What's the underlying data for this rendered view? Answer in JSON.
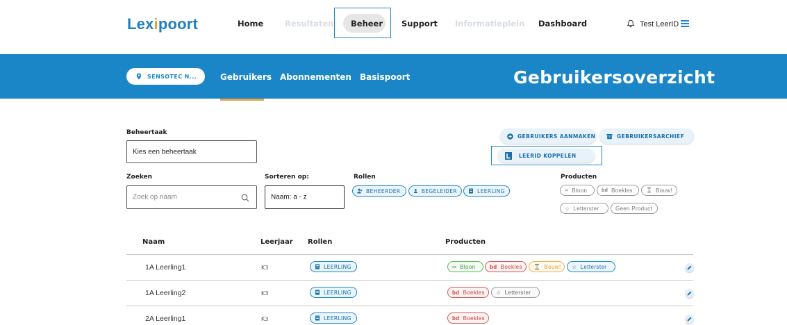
{
  "nav": {
    "logo_prefix": "Lex",
    "logo_i": "i",
    "logo_suffix": "poort",
    "items": [
      {
        "label": "Home",
        "disabled": false
      },
      {
        "label": "Resultaten",
        "disabled": true
      },
      {
        "label": "Beheer",
        "active": true
      },
      {
        "label": "Support",
        "disabled": false
      },
      {
        "label": "Informatieplein",
        "disabled": true
      },
      {
        "label": "Dashboard",
        "disabled": false
      }
    ],
    "user_name": "Test LeerID",
    "bell_icon": "bell-icon",
    "menu_icon": "hamburger-menu-icon"
  },
  "banner": {
    "org_label": "SENSOTEC N...",
    "tabs": [
      "Gebruikers",
      "Abonnementen",
      "Basispoort"
    ],
    "active_tab": "Gebruikers",
    "title": "Gebruikersoverzicht",
    "color": "#1a86c8",
    "accent": "#e6a24b"
  },
  "filters": {
    "beheertaak_label": "Beheertaak",
    "beheertaak_value": "Kies een beheertaak",
    "zoeken_label": "Zoeken",
    "zoeken_placeholder": "Zoek op naam",
    "sorteren_label": "Sorteren op:",
    "sorteren_value": "Naam: a - z",
    "rollen_label": "Rollen",
    "rollen": [
      "BEHEERDER",
      "BEGELEIDER",
      "LEERLING"
    ],
    "producten_label": "Producten",
    "producten": [
      "Bloon",
      "Boekles",
      "Bouw!",
      "Letterster",
      "Geen Product"
    ]
  },
  "actions": {
    "aanmaken": "GEBRUIKERS AANMAKEN",
    "archief": "GEBRUIKERSARCHIEF",
    "koppelen": "LEERID KOPPELEN"
  },
  "table": {
    "headers": {
      "naam": "Naam",
      "leerjaar": "Leerjaar",
      "rollen": "Rollen",
      "producten": "Producten"
    },
    "rows": [
      {
        "naam": "1A Leerling1",
        "leerjaar": "K3",
        "rol": "LEERLING",
        "producten": [
          "Bloon",
          "Boekles",
          "Bouw!",
          "Letterster"
        ]
      },
      {
        "naam": "1A Leerling2",
        "leerjaar": "K3",
        "rol": "LEERLING",
        "producten": [
          "Boekles",
          "Letterster"
        ]
      },
      {
        "naam": "2A Leerling1",
        "leerjaar": "K3",
        "rol": "LEERLING",
        "producten": [
          "Boekles"
        ]
      }
    ]
  }
}
